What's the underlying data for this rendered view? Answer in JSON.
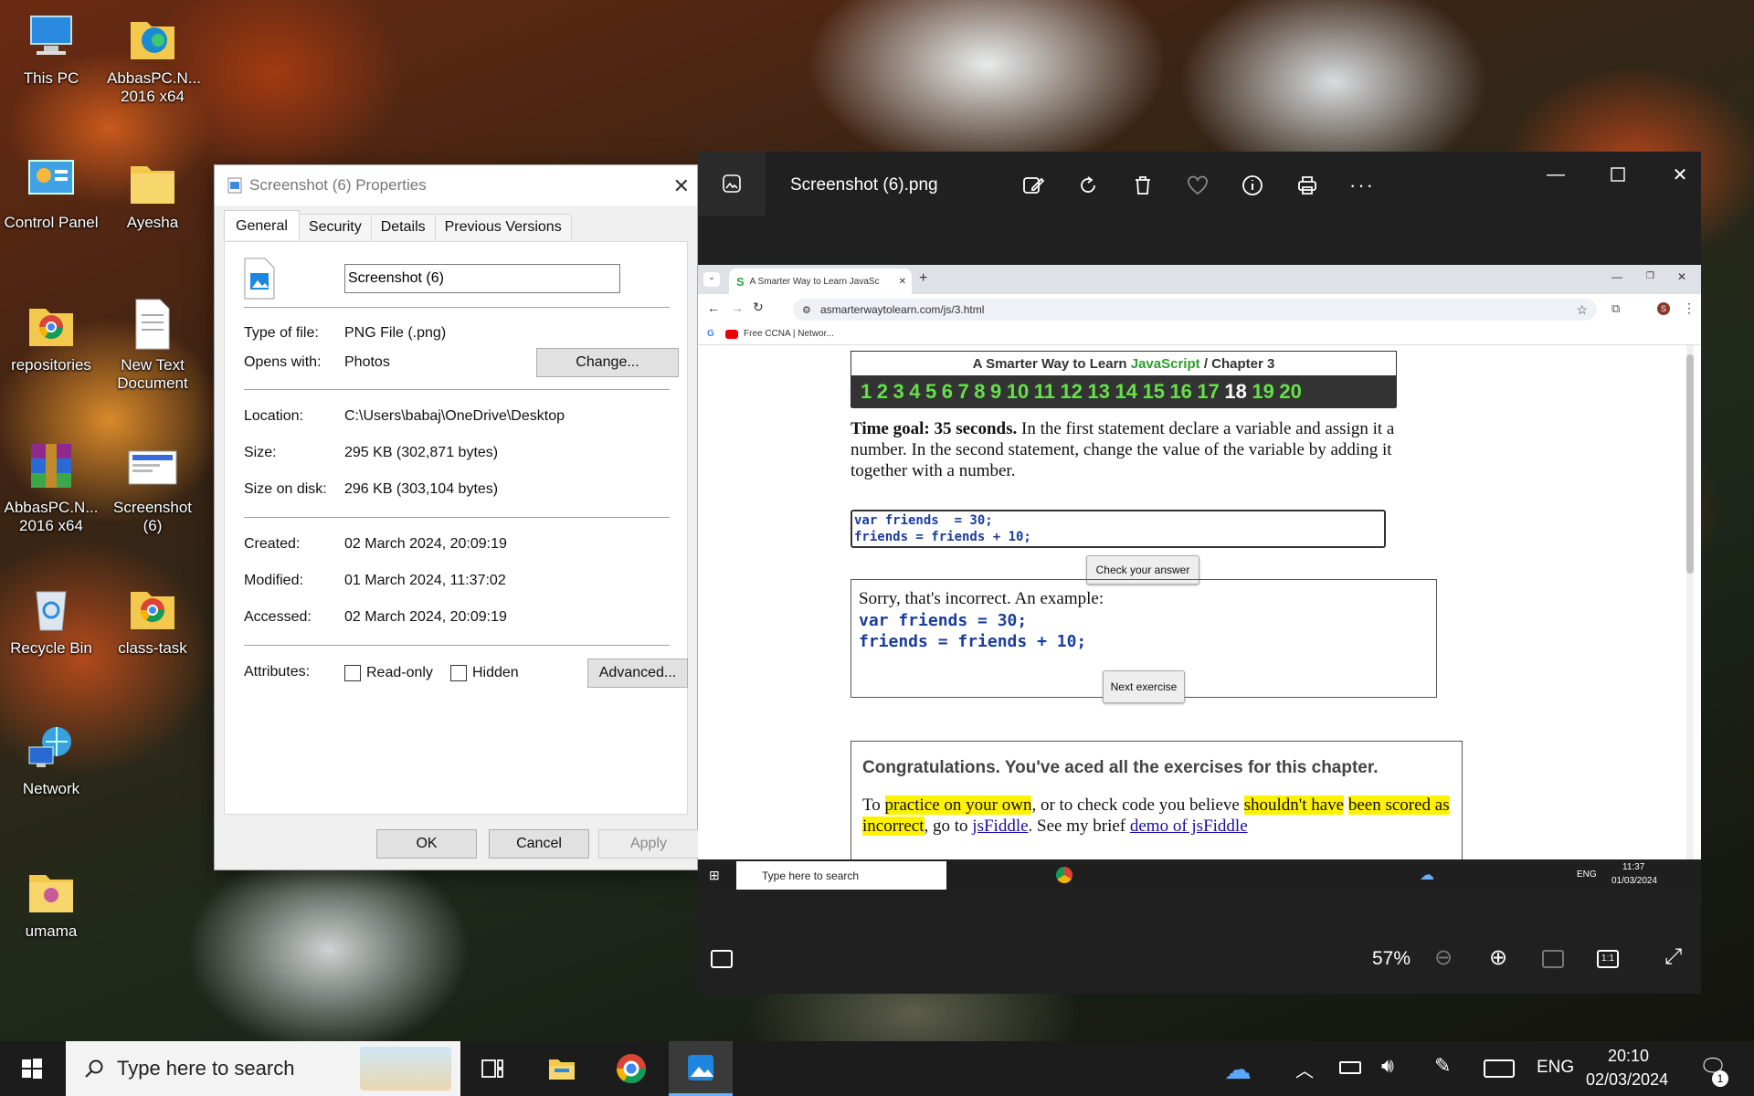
{
  "desktop": {
    "icons": [
      {
        "label": "This PC",
        "icon": "this-pc-icon"
      },
      {
        "label": "AbbasPC.N... 2016 x64",
        "icon": "edge-folder-icon"
      },
      {
        "label": "Control Panel",
        "icon": "control-panel-icon"
      },
      {
        "label": "Ayesha",
        "icon": "folder-icon"
      },
      {
        "label": "repositories",
        "icon": "chrome-folder-icon"
      },
      {
        "label": "New Text Document",
        "icon": "text-document-icon"
      },
      {
        "label": "AbbasPC.N... 2016 x64",
        "icon": "winrar-icon"
      },
      {
        "label": "Screenshot (6)",
        "icon": "image-file-icon"
      },
      {
        "label": "Recycle Bin",
        "icon": "recycle-bin-icon"
      },
      {
        "label": "class-task",
        "icon": "chrome-folder-icon"
      },
      {
        "label": "Network",
        "icon": "network-icon"
      },
      {
        "label": "umama",
        "icon": "folder-icon"
      }
    ]
  },
  "props": {
    "title": "Screenshot (6) Properties",
    "tabs": [
      "General",
      "Security",
      "Details",
      "Previous Versions"
    ],
    "filename": "Screenshot (6)",
    "type_label": "Type of file:",
    "type_value": "PNG File (.png)",
    "opens_label": "Opens with:",
    "opens_value": "Photos",
    "change_label": "Change...",
    "location_label": "Location:",
    "location_value": "C:\\Users\\babaj\\OneDrive\\Desktop",
    "size_label": "Size:",
    "size_value": "295 KB (302,871 bytes)",
    "disk_label": "Size on disk:",
    "disk_value": "296 KB (303,104 bytes)",
    "created_label": "Created:",
    "created_value": "02 March 2024, 20:09:19",
    "modified_label": "Modified:",
    "modified_value": "01 March 2024, 11:37:02",
    "accessed_label": "Accessed:",
    "accessed_value": "02 March 2024, 20:09:19",
    "attributes_label": "Attributes:",
    "readonly_label": "Read-only",
    "hidden_label": "Hidden",
    "advanced_label": "Advanced...",
    "ok_label": "OK",
    "cancel_label": "Cancel",
    "apply_label": "Apply"
  },
  "viewer": {
    "title": "Screenshot (6).png",
    "zoom": "57%",
    "browser": {
      "tab_title": "A Smarter Way to Learn JavaSc",
      "url": "asmarterwaytolearn.com/js/3.html",
      "bookmark": "Free CCNA | Networ...",
      "header_prefix": "A Smarter Way to Learn ",
      "header_js": "JavaScript",
      "header_suffix": " / Chapter 3",
      "chapters": [
        "1",
        "2",
        "3",
        "4",
        "5",
        "6",
        "7",
        "8",
        "9",
        "10",
        "11",
        "12",
        "13",
        "14",
        "15",
        "16",
        "17",
        "18",
        "19",
        "20"
      ],
      "goal_bold": "Time goal: 35 seconds.",
      "goal_text": " In the first statement declare a variable and assign it a number. In the second statement, change the value of the variable by adding it together with a number.",
      "code_line1": "var friends  = 30;",
      "code_line2": "friends = friends + 10;",
      "check_label": "Check your answer",
      "sorry_text": "Sorry, that's incorrect. An example:",
      "example_line1": "var friends = 30;",
      "example_line2": "friends = friends + 10;",
      "next_label": "Next exercise",
      "congrats_title": "Congratulations. You've aced all the exercises for this chapter.",
      "cp_1": "To ",
      "cp_hl1": "practice on your own",
      "cp_2": ", or to check code you believe ",
      "cp_hl2": "shouldn't have",
      "cp_hl3": "been scored as incorrect",
      "cp_3": ", go to ",
      "cp_link1": "jsFiddle",
      "cp_4": ". See my brief ",
      "cp_link2": "demo of jsFiddle",
      "inner_search": "Type here to search",
      "inner_lang": "ENG",
      "inner_time": "11:37",
      "inner_date": "01/03/2024"
    }
  },
  "taskbar": {
    "search_placeholder": "Type here to search",
    "lang": "ENG",
    "time": "20:10",
    "date": "02/03/2024",
    "notifications": "1"
  }
}
